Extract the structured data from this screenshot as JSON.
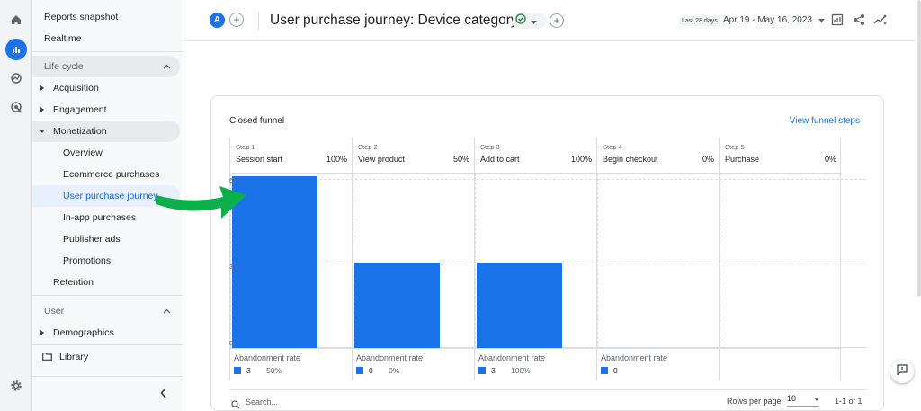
{
  "rail": {
    "icons": [
      "home-icon",
      "reports-icon",
      "explore-icon",
      "advertising-icon",
      "settings-icon"
    ]
  },
  "sidebar": {
    "reports_snapshot": "Reports snapshot",
    "realtime": "Realtime",
    "lifecycle": "Life cycle",
    "acquisition": "Acquisition",
    "engagement": "Engagement",
    "monetization": "Monetization",
    "overview": "Overview",
    "ecommerce_purchases": "Ecommerce purchases",
    "user_purchase_journey": "User purchase journey",
    "in_app_purchases": "In-app purchases",
    "publisher_ads": "Publisher ads",
    "promotions": "Promotions",
    "retention": "Retention",
    "user": "User",
    "demographics": "Demographics",
    "library": "Library"
  },
  "header": {
    "avatar_letter": "A",
    "title": "User purchase journey: Device category",
    "date_badge": "Last 28 days",
    "date_range": "Apr 19 - May 16, 2023"
  },
  "card": {
    "title": "Closed funnel",
    "funnel_link": "View funnel steps",
    "yticks": [
      "6.1",
      "3.1",
      "0"
    ],
    "search_placeholder": "Search...",
    "rows_per_page_label": "Rows per page:",
    "rows_per_page_value": "10",
    "pagination": "1-1 of 1"
  },
  "colors": {
    "accent": "#1a73e8",
    "arrow": "#0bb04b"
  },
  "chart_data": {
    "type": "bar",
    "title": "Closed funnel",
    "ylim": [
      0,
      6.1
    ],
    "yticks": [
      "6.1",
      "3.1",
      "0"
    ],
    "steps": [
      {
        "step": "Step 1",
        "name": "Session start",
        "percent": "100%",
        "value": 6,
        "abandonment_label": "Abandonment rate",
        "abandonment_count": "3",
        "abandonment_rate": "50%"
      },
      {
        "step": "Step 2",
        "name": "View product",
        "percent": "50%",
        "value": 3,
        "abandonment_label": "Abandonment rate",
        "abandonment_count": "0",
        "abandonment_rate": "0%"
      },
      {
        "step": "Step 3",
        "name": "Add to cart",
        "percent": "100%",
        "value": 3,
        "abandonment_label": "Abandonment rate",
        "abandonment_count": "3",
        "abandonment_rate": "100%"
      },
      {
        "step": "Step 4",
        "name": "Begin checkout",
        "percent": "0%",
        "value": 0,
        "abandonment_label": "Abandonment rate",
        "abandonment_count": "0",
        "abandonment_rate": ""
      },
      {
        "step": "Step 5",
        "name": "Purchase",
        "percent": "0%",
        "value": 0,
        "abandonment_label": "",
        "abandonment_count": "",
        "abandonment_rate": ""
      }
    ]
  }
}
